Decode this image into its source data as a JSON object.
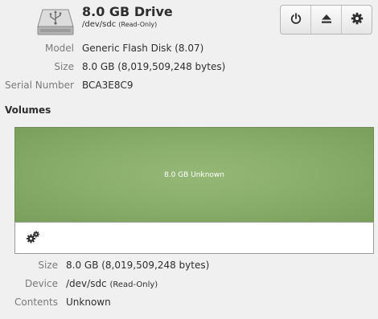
{
  "drive": {
    "title": "8.0 GB Drive",
    "device": "/dev/sdc",
    "read_only": "(Read-Only)",
    "icon": "usb-drive-icon"
  },
  "toolbar": {
    "power_icon": "power-icon",
    "eject_icon": "eject-icon",
    "settings_icon": "gear-icon"
  },
  "properties": [
    {
      "label": "Model",
      "value": "Generic Flash Disk (8.07)"
    },
    {
      "label": "Size",
      "value": "8.0 GB (8,019,509,248 bytes)"
    },
    {
      "label": "Serial Number",
      "value": "BCA3E8C9"
    }
  ],
  "volumes": {
    "title": "Volumes",
    "block_label": "8.0 GB Unknown",
    "block_color": "#8aae6b",
    "actions_icon": "gears-icon"
  },
  "volume_details": [
    {
      "label": "Size",
      "value": "8.0 GB (8,019,509,248 bytes)"
    },
    {
      "label": "Device",
      "value": "/dev/sdc",
      "suffix": "(Read-Only)"
    },
    {
      "label": "Contents",
      "value": "Unknown"
    }
  ]
}
